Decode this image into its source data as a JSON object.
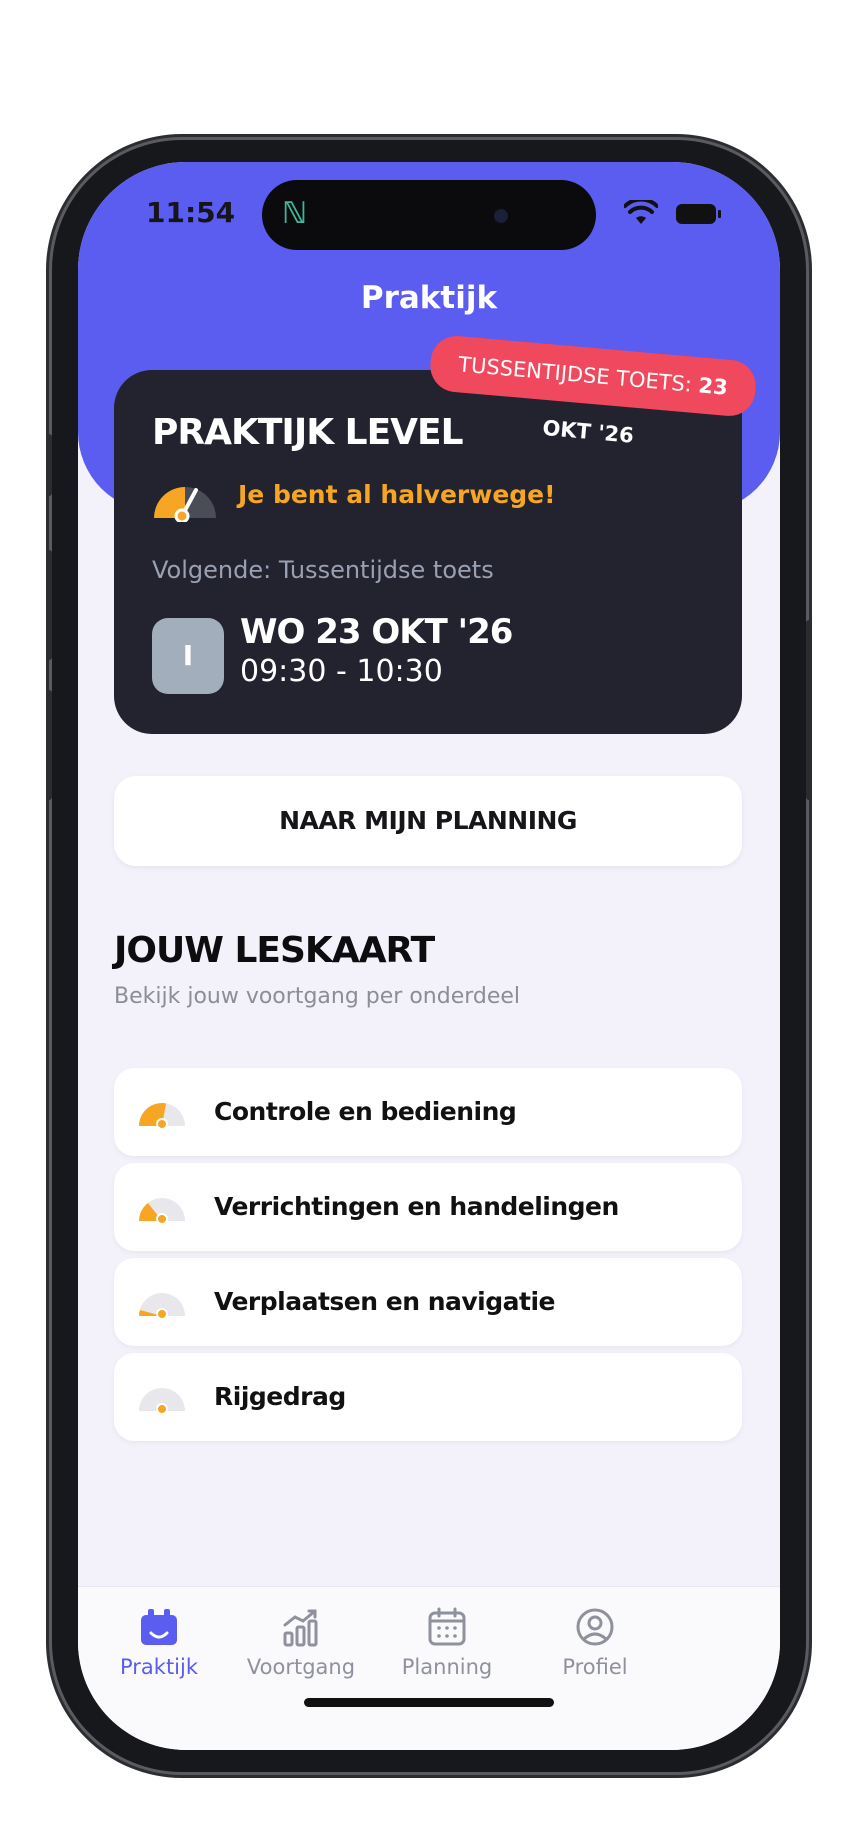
{
  "status_bar": {
    "time": "11:54"
  },
  "header": {
    "title": "Praktijk"
  },
  "level_card": {
    "tag_prefix": "TUSSENTIJDSE TOETS:",
    "tag_date": "23 OKT '26",
    "title": "PRAKTIJK LEVEL",
    "progress_text": "Je bent al halverwege!",
    "next_label": "Volgende: Tussentijdse toets",
    "day_badge": "I",
    "date": "WO 23 OKT '26",
    "time": "09:30 - 10:30"
  },
  "planning_button": {
    "label": "NAAR MIJN PLANNING"
  },
  "lesson_card": {
    "title": "JOUW LESKAART",
    "subtitle": "Bekijk jouw voortgang per onderdeel",
    "items": [
      {
        "label": "Controle en bediening",
        "icon": "gauge-icon"
      },
      {
        "label": "Verrichtingen en handelingen",
        "icon": "gauge-icon"
      },
      {
        "label": "Verplaatsen en navigatie",
        "icon": "gauge-icon"
      },
      {
        "label": "Rijgedrag",
        "icon": "gauge-icon"
      }
    ]
  },
  "tab_bar": {
    "tabs": [
      {
        "label": "Praktijk",
        "icon": "praktijk-icon",
        "active": true
      },
      {
        "label": "Voortgang",
        "icon": "chart-icon",
        "active": false
      },
      {
        "label": "Planning",
        "icon": "calendar-icon",
        "active": false
      },
      {
        "label": "Profiel",
        "icon": "profile-icon",
        "active": false
      }
    ]
  },
  "colors": {
    "primary": "#5b5cf0",
    "card_dark": "#22232e",
    "accent_orange": "#f6a623",
    "tag_red": "#f0485d",
    "background": "#f3f2fb"
  }
}
